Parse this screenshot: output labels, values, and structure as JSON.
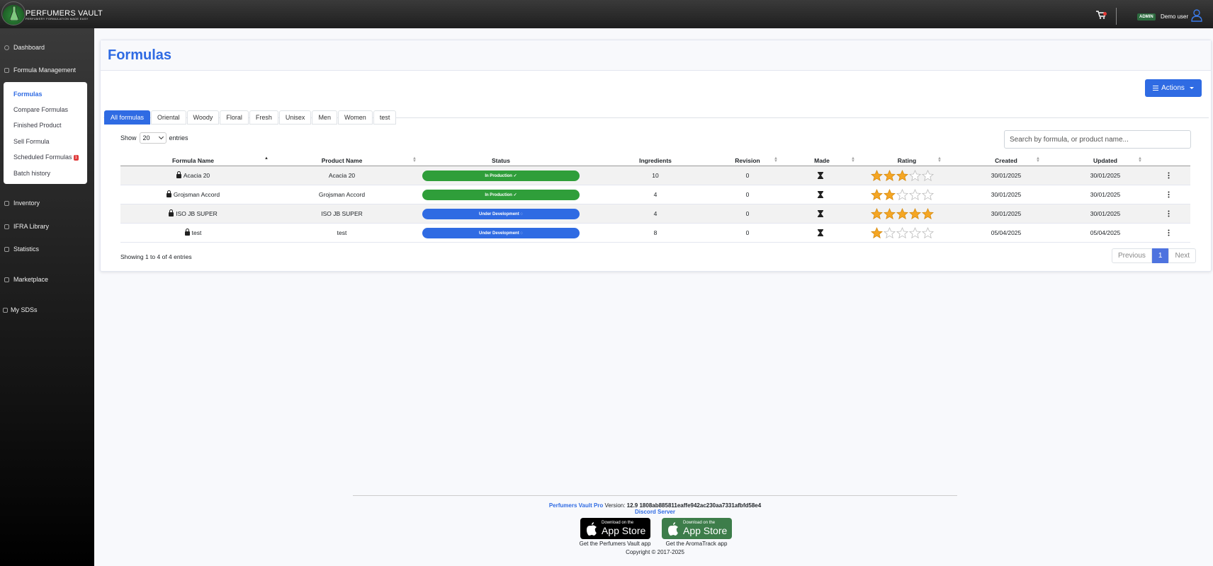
{
  "header": {
    "brand": "PERFUMERS VAULT",
    "brand_sub": "PERFUMERY FORMULATION MADE EASY",
    "admin_badge": "ADMIN",
    "user_name": "Demo user"
  },
  "sidebar": {
    "items": [
      {
        "label": "Dashboard"
      },
      {
        "label": "Formula Management"
      },
      {
        "label": "Inventory"
      },
      {
        "label": "IFRA Library"
      },
      {
        "label": "Statistics"
      },
      {
        "label": "Marketplace"
      },
      {
        "label": "My SDSs"
      }
    ],
    "submenu": [
      {
        "label": "Formulas"
      },
      {
        "label": "Compare Formulas"
      },
      {
        "label": "Finished Product"
      },
      {
        "label": "Sell Formula"
      },
      {
        "label": "Scheduled Formulas",
        "badge": "1"
      },
      {
        "label": "Batch history"
      }
    ]
  },
  "page": {
    "title": "Formulas",
    "actions_label": "Actions"
  },
  "tabs": [
    "All formulas",
    "Oriental",
    "Woody",
    "Floral",
    "Fresh",
    "Unisex",
    "Men",
    "Women",
    "test"
  ],
  "entries": {
    "show_label": "Show",
    "value": "20",
    "entries_label": "entries"
  },
  "search": {
    "placeholder": "Search by formula, or product name..."
  },
  "table": {
    "columns": [
      "Formula Name",
      "Product Name",
      "Status",
      "Ingredients",
      "Revision",
      "Made",
      "Rating",
      "Created",
      "Updated"
    ],
    "rows": [
      {
        "formula": "Acacia 20",
        "product": "Acacia 20",
        "status": "In Production ✓",
        "status_type": "prod",
        "ingredients": "10",
        "revision": "0",
        "rating": 3,
        "created": "30/01/2025",
        "updated": "30/01/2025"
      },
      {
        "formula": "Grojsman Accord",
        "product": "Grojsman Accord",
        "status": "In Production ✓",
        "status_type": "prod",
        "ingredients": "4",
        "revision": "0",
        "rating": 2,
        "created": "30/01/2025",
        "updated": "30/01/2025"
      },
      {
        "formula": "ISO JB SUPER",
        "product": "ISO JB SUPER",
        "status": "Under Development ◌",
        "status_type": "dev",
        "ingredients": "4",
        "revision": "0",
        "rating": 5,
        "created": "30/01/2025",
        "updated": "30/01/2025"
      },
      {
        "formula": "test",
        "product": "test",
        "status": "Under Development ◌",
        "status_type": "dev",
        "ingredients": "8",
        "revision": "0",
        "rating": 1,
        "created": "05/04/2025",
        "updated": "05/04/2025"
      }
    ]
  },
  "footer_table": {
    "showing": "Showing 1 to 4 of 4 entries",
    "previous": "Previous",
    "page": "1",
    "next": "Next"
  },
  "footer": {
    "brand_link": "Perfumers Vault Pro",
    "version_label": "Version:",
    "version": "12.9 1808ab885811eaffe942ac230aa7331afbfd58e4",
    "discord": "Discord Server",
    "store_small": "Download on the",
    "store_big": "App Store",
    "caption_pv": "Get the Perfumers Vault app",
    "caption_at": "Get the AromaTrack app",
    "copyright": "Copyright © 2017-2025"
  },
  "colors": {
    "accent": "#2f6be3",
    "production": "#2f9e3a",
    "star": "#f5a623"
  }
}
